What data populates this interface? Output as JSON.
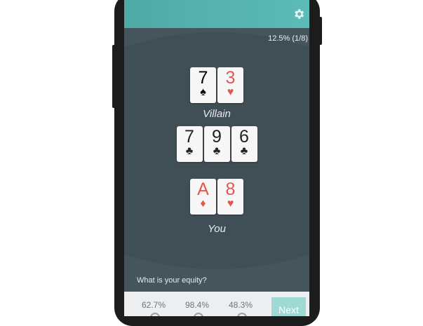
{
  "header": {
    "settings_icon": "gear-icon"
  },
  "progress": "12.5% (1/8)",
  "villain": {
    "label": "Villain",
    "cards": [
      {
        "rank": "7",
        "suit": "♠",
        "color": "#222222"
      },
      {
        "rank": "3",
        "suit": "♥",
        "color": "#e3574f"
      }
    ]
  },
  "board": {
    "cards": [
      {
        "rank": "7",
        "suit": "♣",
        "color": "#222222"
      },
      {
        "rank": "9",
        "suit": "♣",
        "color": "#222222"
      },
      {
        "rank": "6",
        "suit": "♣",
        "color": "#222222"
      }
    ]
  },
  "hero": {
    "label": "You",
    "cards": [
      {
        "rank": "A",
        "suit": "♦",
        "color": "#e3574f"
      },
      {
        "rank": "8",
        "suit": "♥",
        "color": "#e3574f"
      }
    ]
  },
  "question": "What is your equity?",
  "options": [
    "62.7%",
    "98.4%",
    "48.3%"
  ],
  "next_label": "Next",
  "colors": {
    "accent": "#5cbcb8",
    "felt": "#404f56",
    "background": "#46555c",
    "red_suit": "#e3574f"
  }
}
